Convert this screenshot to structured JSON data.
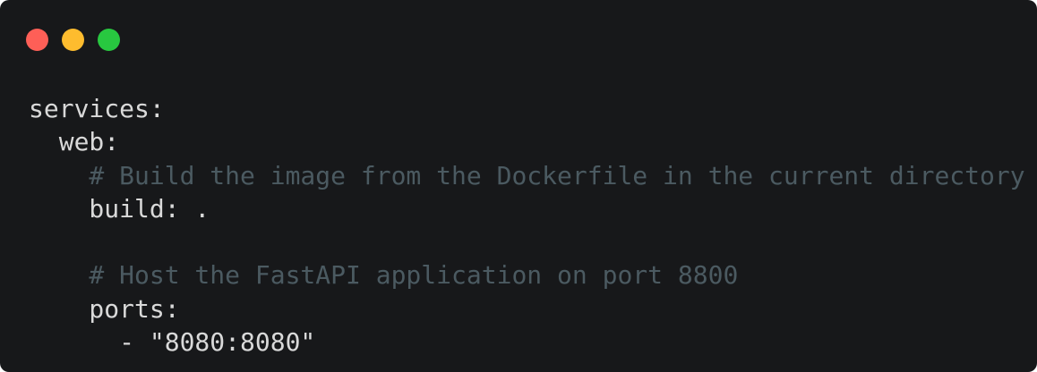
{
  "window": {
    "controls": [
      {
        "name": "close",
        "color": "#fe5f57"
      },
      {
        "name": "minimize",
        "color": "#febc2e"
      },
      {
        "name": "maximize",
        "color": "#28c840"
      }
    ]
  },
  "code": {
    "lines": [
      {
        "text": "services:",
        "type": "code"
      },
      {
        "text": "  web:",
        "type": "code"
      },
      {
        "text": "    # Build the image from the Dockerfile in the current directory",
        "type": "comment"
      },
      {
        "text": "    build: .",
        "type": "code"
      },
      {
        "text": "",
        "type": "blank"
      },
      {
        "text": "    # Host the FastAPI application on port 8800",
        "type": "comment"
      },
      {
        "text": "    ports:",
        "type": "code"
      },
      {
        "text": "      - \"8080:8080\"",
        "type": "code"
      }
    ]
  }
}
